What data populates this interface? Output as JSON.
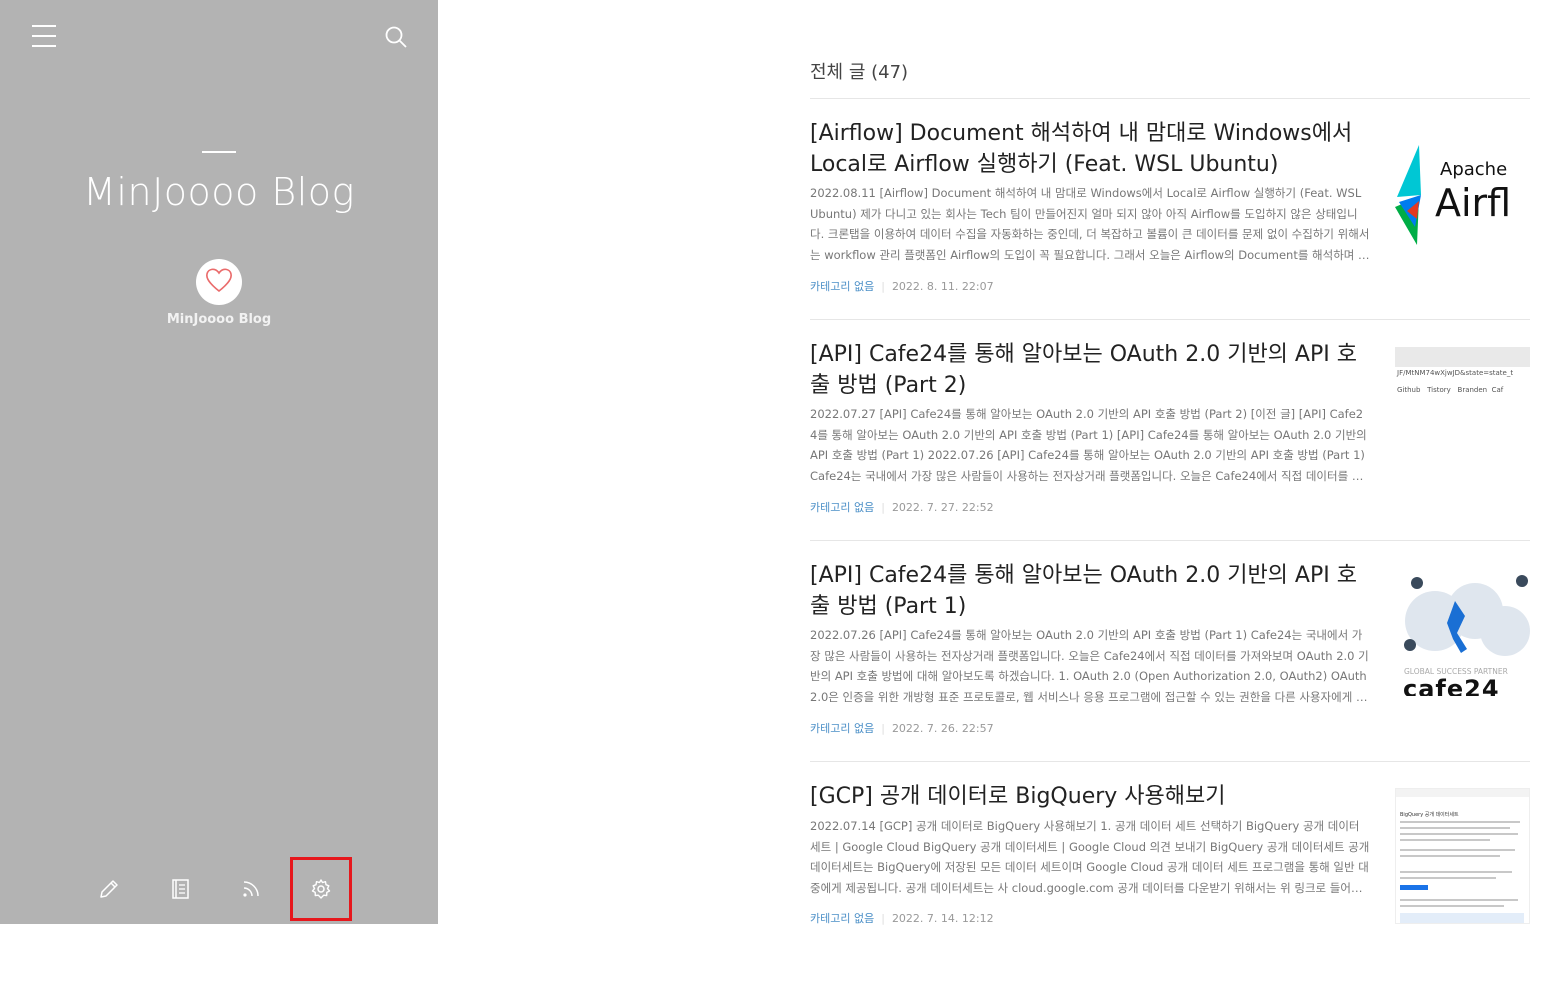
{
  "sidebar": {
    "blog_title": "MinJoooo Blog",
    "owner_name": "MinJoooo Blog",
    "icons": [
      "menu-icon",
      "search-icon",
      "heart-icon",
      "pencil-icon",
      "book-icon",
      "rss-icon",
      "gear-icon"
    ],
    "highlight_color": "#e6171c"
  },
  "main": {
    "heading": "전체 글 (47)",
    "posts": [
      {
        "title": "[Airflow] Document 해석하여 내 맘대로 Windows에서 Local로 Airflow 실행하기 (Feat. WSL Ubuntu)",
        "excerpt": "2022.08.11 [Airflow] Document 해석하여 내 맘대로 Windows에서 Local로 Airflow 실행하기 (Feat. WSL Ubuntu) 제가 다니고 있는 회사는 Tech 팀이 만들어진지 얼마 되지 않아 아직 Airflow를 도입하지 않은 상태입니다. 크론탭을 이용하여 데이터 수집을 자동화하는 중인데, 더 복잡하고 볼륨이 큰 데이터를 문제 없이 수집하기 위해서는 workflow 관리 플랫폼인 Airflow의 도입이 꼭 필요합니다. 그래서 오늘은 Airflow의 Document를 해석하며 제 마음…",
        "category": "카테고리 없음",
        "date": "2022. 8. 11. 22:07",
        "thumb": {
          "top": "Apache",
          "bottom": "Airfl"
        }
      },
      {
        "title": "[API] Cafe24를 통해 알아보는 OAuth 2.0 기반의 API 호출 방법 (Part 2)",
        "excerpt": "2022.07.27 [API] Cafe24를 통해 알아보는 OAuth 2.0 기반의 API 호출 방법 (Part 2) [이전 글] [API] Cafe24를 통해 알아보는 OAuth 2.0 기반의 API 호출 방법 (Part 1) [API] Cafe24를 통해 알아보는 OAuth 2.0 기반의 API 호출 방법 (Part 1) 2022.07.26 [API] Cafe24를 통해 알아보는 OAuth 2.0 기반의 API 호출 방법 (Part 1) Cafe24는 국내에서 가장 많은 사람들이 사용하는 전자상거래 플랫폼입니다. 오늘은 Cafe24에서 직접 데이터를 가져와보며 O…",
        "category": "카테고리 없음",
        "date": "2022. 7. 27. 22:52",
        "thumb": {
          "url": "JF/MtNM74wXjwJD&state=state_t",
          "bookmarks": [
            "Github",
            "Tistory",
            "Branden",
            "Caf"
          ]
        }
      },
      {
        "title": "[API] Cafe24를 통해 알아보는 OAuth 2.0 기반의 API 호출 방법 (Part 1)",
        "excerpt": "2022.07.26 [API] Cafe24를 통해 알아보는 OAuth 2.0 기반의 API 호출 방법 (Part 1) Cafe24는 국내에서 가장 많은 사람들이 사용하는 전자상거래 플랫폼입니다. 오늘은 Cafe24에서 직접 데이터를 가져와보며 OAuth 2.0 기반의 API 호출 방법에 대해 알아보도록 하겠습니다. 1. OAuth 2.0 (Open Authorization 2.0, OAuth2) OAuth 2.0은 인증을 위한 개방형 표준 프로토콜로, 웹 서비스나 응용 프로그램에 접근할 수 있는 권한을 다른 사용자에게 위임할 …",
        "category": "카테고리 없음",
        "date": "2022. 7. 26. 22:57",
        "thumb": {
          "tagline": "GLOBAL SUCCESS PARTNER",
          "logo": "cafe24"
        }
      },
      {
        "title": "[GCP] 공개 데이터로 BigQuery 사용해보기",
        "excerpt": "2022.07.14 [GCP] 공개 데이터로 BigQuery 사용해보기 1. 공개 데이터 세트 선택하기 BigQuery 공개 데이터세트 | Google Cloud BigQuery 공개 데이터세트 | Google Cloud 의견 보내기 BigQuery 공개 데이터세트 공개 데이터세트는 BigQuery에 저장된 모든 데이터 세트이며 Google Cloud 공개 데이터 세트 프로그램을 통해 일반 대중에게 제공됩니다. 공개 데이터세트는 사 cloud.google.com 공개 데이터를 다운받기 위해서는 위 링크로 들어가주세요. …",
        "category": "카테고리 없음",
        "date": "2022. 7. 14. 12:12",
        "thumb": {
          "page_title": "BigQuery 공개 데이터세트"
        }
      }
    ]
  }
}
